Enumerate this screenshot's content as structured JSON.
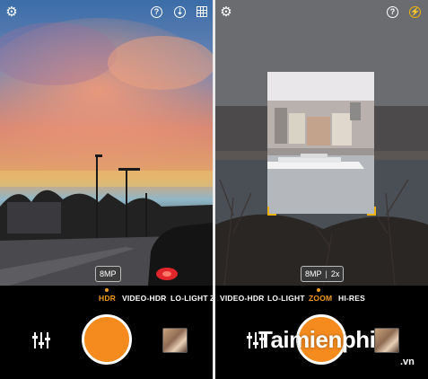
{
  "left_screen": {
    "top_bar": {
      "settings_icon": "gear-icon",
      "help_label": "?",
      "compass_icon": "compass-icon",
      "grid_icon": "grid-icon"
    },
    "resolution_badge": "8MP",
    "modes": [
      "HDR",
      "VIDEO-HDR",
      "LO-LIGHT",
      "Z"
    ],
    "active_mode": "HDR"
  },
  "right_screen": {
    "top_bar": {
      "settings_icon": "gear-icon",
      "help_label": "?",
      "flash_icon": "flash-icon"
    },
    "resolution_badge": "8MP",
    "zoom_badge": "2x",
    "modes": [
      "VIDEO-HDR",
      "LO-LIGHT",
      "ZOOM",
      "HI-RES"
    ],
    "active_mode": "ZOOM"
  },
  "watermark": {
    "text": "Taimienphi",
    "suffix": ".vn"
  },
  "colors": {
    "accent": "#f39a1e",
    "shutter": "#f58b1e",
    "flash_active": "#f0b400"
  }
}
